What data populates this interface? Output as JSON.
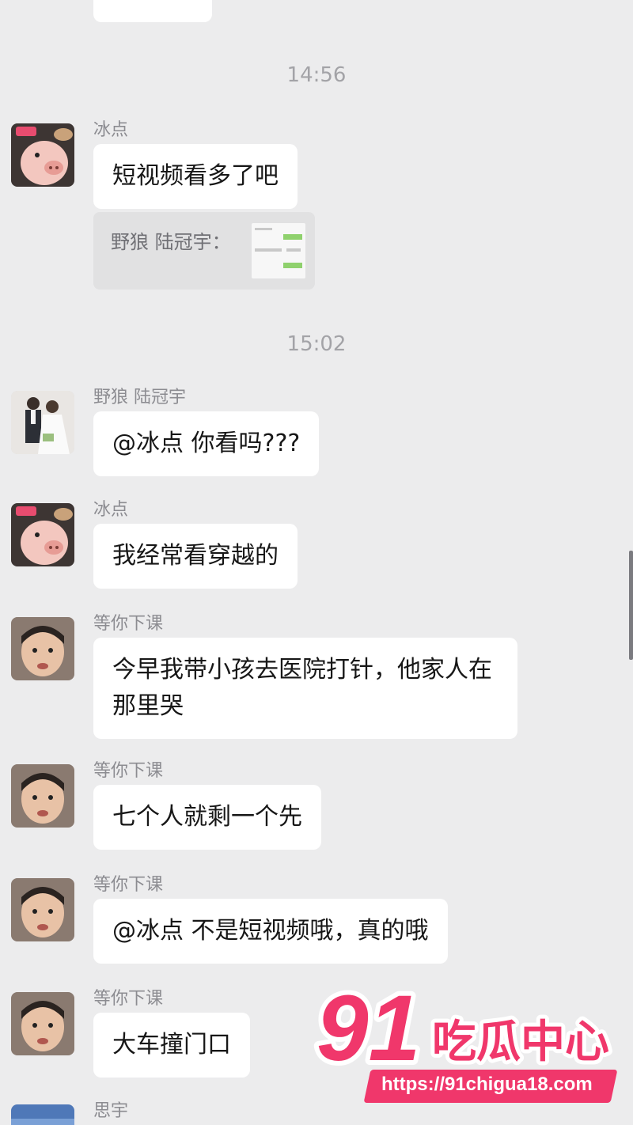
{
  "chat": {
    "timestamps": [
      "14:56",
      "15:02"
    ],
    "messages": [
      {
        "sender": "冰点",
        "text": "短视频看多了吧",
        "avatar": "pig-cartoon-avatar"
      },
      {
        "quote": "野狼 陆冠宇："
      },
      {
        "sender": "野狼 陆冠宇",
        "text": "@冰点 你看吗???",
        "avatar": "wedding-photo-avatar"
      },
      {
        "sender": "冰点",
        "text": "我经常看穿越的",
        "avatar": "pig-cartoon-avatar"
      },
      {
        "sender": "等你下课",
        "text": "今早我带小孩去医院打针，他家人在那里哭",
        "avatar": "child-face-avatar"
      },
      {
        "sender": "等你下课",
        "text": "七个人就剩一个先",
        "avatar": "child-face-avatar"
      },
      {
        "sender": "等你下课",
        "text": "@冰点 不是短视频哦，真的哦",
        "avatar": "child-face-avatar"
      },
      {
        "sender": "等你下课",
        "text": "大车撞门口",
        "avatar": "child-face-avatar"
      },
      {
        "sender": "思宇",
        "avatar": "sky-avatar"
      }
    ]
  },
  "watermark": {
    "number": "91",
    "brand": "吃瓜中心",
    "url": "https://91chigua18.com",
    "colors": {
      "accent": "#f0376b",
      "ink": "#ffffff"
    }
  }
}
